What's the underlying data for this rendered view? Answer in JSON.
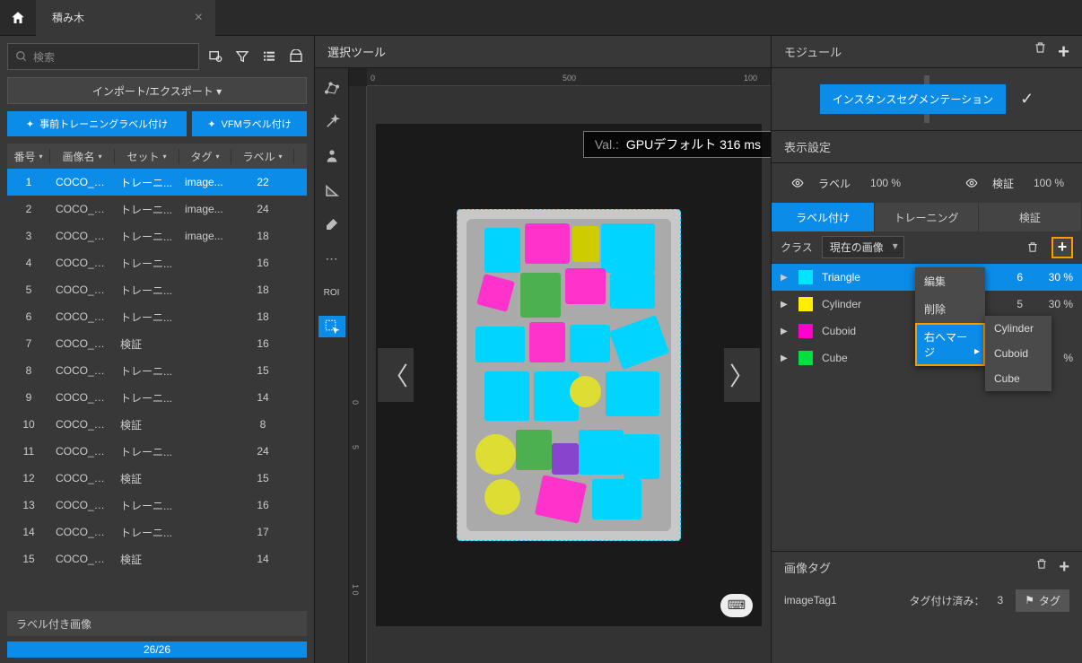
{
  "titlebar": {
    "tab_title": "積み木"
  },
  "left": {
    "search_placeholder": "検索",
    "import_export": "インポート/エクスポート ▾",
    "pretrain_btn": "事前トレーニングラベル付け",
    "vfm_btn": "VFMラベル付け",
    "headers": {
      "num": "番号",
      "name": "画像名",
      "set": "セット",
      "tag": "タグ",
      "label": "ラベル"
    },
    "rows": [
      {
        "n": "1",
        "name": "COCO_va...",
        "set": "トレーニ...",
        "tag": "image...",
        "label": "22",
        "sel": true
      },
      {
        "n": "2",
        "name": "COCO_va...",
        "set": "トレーニ...",
        "tag": "image...",
        "label": "24"
      },
      {
        "n": "3",
        "name": "COCO_va...",
        "set": "トレーニ...",
        "tag": "image...",
        "label": "18"
      },
      {
        "n": "4",
        "name": "COCO_va...",
        "set": "トレーニ...",
        "tag": "",
        "label": "16"
      },
      {
        "n": "5",
        "name": "COCO_va...",
        "set": "トレーニ...",
        "tag": "",
        "label": "18"
      },
      {
        "n": "6",
        "name": "COCO_va...",
        "set": "トレーニ...",
        "tag": "",
        "label": "18"
      },
      {
        "n": "7",
        "name": "COCO_va...",
        "set": "検証",
        "tag": "",
        "label": "16"
      },
      {
        "n": "8",
        "name": "COCO_va...",
        "set": "トレーニ...",
        "tag": "",
        "label": "15"
      },
      {
        "n": "9",
        "name": "COCO_va...",
        "set": "トレーニ...",
        "tag": "",
        "label": "14"
      },
      {
        "n": "10",
        "name": "COCO_va...",
        "set": "検証",
        "tag": "",
        "label": "8"
      },
      {
        "n": "11",
        "name": "COCO_va...",
        "set": "トレーニ...",
        "tag": "",
        "label": "24"
      },
      {
        "n": "12",
        "name": "COCO_va...",
        "set": "検証",
        "tag": "",
        "label": "15"
      },
      {
        "n": "13",
        "name": "COCO_va...",
        "set": "トレーニ...",
        "tag": "",
        "label": "16"
      },
      {
        "n": "14",
        "name": "COCO_va...",
        "set": "トレーニ...",
        "tag": "",
        "label": "17"
      },
      {
        "n": "15",
        "name": "COCO_va...",
        "set": "検証",
        "tag": "",
        "label": "14"
      }
    ],
    "footer_label": "ラベル付き画像",
    "progress": "26/26"
  },
  "center": {
    "header": "選択ツール",
    "ruler_h": [
      "0",
      "500",
      "100"
    ],
    "ruler_v": [
      "0",
      "5",
      "1 0"
    ],
    "val_label": "Val.:",
    "val_text": "GPUデフォルト 316 ms",
    "tool_roi": "ROI"
  },
  "right": {
    "module_header": "モジュール",
    "module_chip": "インスタンスセグメンテーション",
    "display_header": "表示設定",
    "disp_label": "ラベル",
    "disp_label_pct": "100 %",
    "disp_verify": "検証",
    "disp_verify_pct": "100 %",
    "tabs": {
      "labeling": "ラベル付け",
      "training": "トレーニング",
      "verify": "検証"
    },
    "class_label": "クラス",
    "dropdown": "現在の画像",
    "classes": [
      {
        "name": "Triangle",
        "color": "#00e5ff",
        "count": "6",
        "pct": "30 %",
        "sel": true
      },
      {
        "name": "Cylinder",
        "color": "#ffee00",
        "count": "5",
        "pct": "30 %"
      },
      {
        "name": "Cuboid",
        "color": "#ff00cc",
        "count": "",
        "pct": ""
      },
      {
        "name": "Cube",
        "color": "#00e040",
        "count": "",
        "pct": "%"
      }
    ],
    "context": {
      "edit": "編集",
      "delete": "削除",
      "merge": "右へマージ"
    },
    "submenu": [
      "Cylinder",
      "Cuboid",
      "Cube"
    ],
    "tags_header": "画像タグ",
    "tag_name": "imageTag1",
    "tagged_label": "タグ付け済み：",
    "tagged_count": "3",
    "tag_btn": "タグ"
  }
}
